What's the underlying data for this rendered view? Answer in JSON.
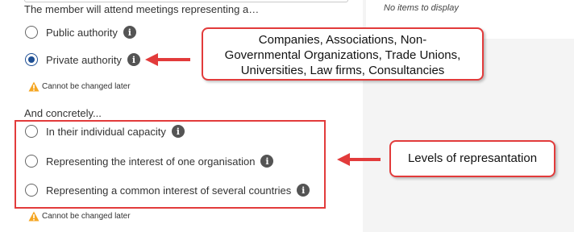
{
  "right_panel": {
    "empty_text": "No items to display"
  },
  "question": "The member will attend meetings representing a…",
  "authority_options": [
    {
      "label": "Public authority",
      "selected": false
    },
    {
      "label": "Private authority",
      "selected": true
    }
  ],
  "warning_text": "Cannot be changed later",
  "concretely_label": "And concretely...",
  "capacity_options": [
    {
      "label": "In their individual capacity",
      "selected": false
    },
    {
      "label": "Representing the interest of one organisation",
      "selected": false
    },
    {
      "label": "Representing a common interest of several countries",
      "selected": false
    }
  ],
  "callouts": {
    "private_examples": [
      "Companies, Associations, Non-",
      "Governmental Organizations, Trade Unions,",
      "Universities, Law firms, Consultancies"
    ],
    "levels": "Levels of represantation"
  },
  "icons": {
    "info": "info-icon",
    "warning": "warning-icon",
    "arrow": "red-arrow"
  },
  "colors": {
    "annotation_red": "#e23b3b",
    "radio_selected": "#1e4f94",
    "warning": "#f5a623"
  }
}
